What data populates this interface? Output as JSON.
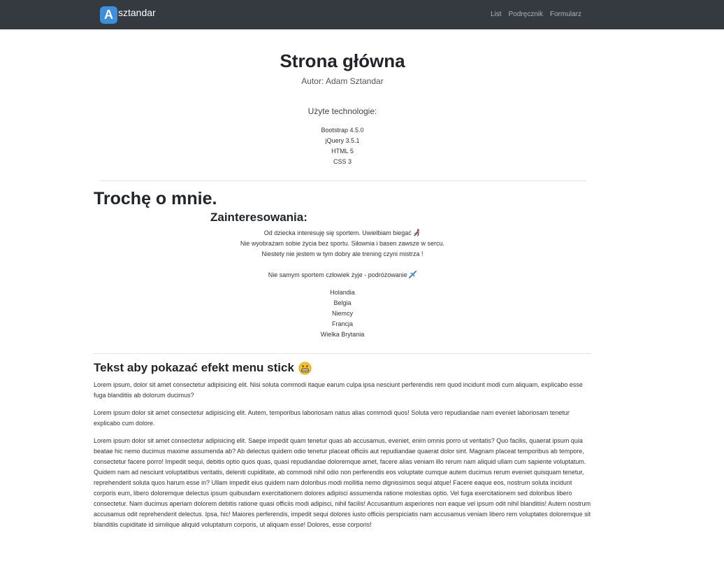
{
  "navbar": {
    "logo_letter": "A",
    "brand_text": "sztandar",
    "links": [
      "List",
      "Podręcznik",
      "Formularz"
    ]
  },
  "header": {
    "title": "Strona główna",
    "author": "Autor: Adam Sztandar",
    "tech_title": "Użyte technologie:",
    "technologies": [
      "Bootstrap 4.5.0",
      "jQuery 3.5.1",
      "HTML 5",
      "CSS 3"
    ]
  },
  "about": {
    "title": "Trochę o mnie.",
    "interests_title": "Zainteresowania:",
    "interests_lines": [
      "Od dziecka interesuję się sportem. Uwielbiam biegać",
      "Nie wyobrażam sobie życia bez sportu. Siłownia i basen zawsze w sercu.",
      "Niestety nie jestem w tym dobry ale trening czyni mistrza !"
    ],
    "travel_line": "Nie samym sportem człowiek żyje - podróżowanie",
    "countries": [
      "Holandia",
      "Belgia",
      "Niemcy",
      "Francja",
      "Wielka Brytania"
    ]
  },
  "sticky": {
    "title": "Tekst aby pokazać efekt menu stick",
    "paragraphs": [
      "Lorem ipsum, dolor sit amet consectetur adipisicing elit. Nisi soluta commodi itaque earum culpa ipsa nesciunt perferendis rem quod incidunt modi cum aliquam, explicabo esse fuga blanditiis ab dolorum ducimus?",
      "Lorem ipsum dolor sit amet consectetur adipisicing elit. Autem, temporibus laboriosam natus alias commodi quos! Soluta vero repudiandae nam eveniet laboriosam tenetur explicabo cum dolore.",
      "Lorem ipsum dolor sit amet consectetur adipisicing elit. Saepe impedit quam tenetur quas ab accusamus, eveniet, enim omnis porro ut veritatis? Quo facilis, quaerat ipsum quia beatae hic nemo ducimus maxime assumenda ab? Ab delectus quidem odio tenetur placeat officiis aut repudiandae quaerat dolor sint. Magnam placeat temporibus ab tempore, consectetur facere porro! Impedit sequi, debitis optio quos quas, quasi repudiandae doloremque amet, facere alias veniam illo rerum nam aliquid ullam cum sapiente voluptatum. Quidem nam ad nesciunt voluptatibus veritatis, deleniti cupiditate, ab commodi nihil odio non perferendis eos voluptate cumque autem ducimus rerum eveniet quisquam tenetur, reprehenderit soluta quos harum esse in? Ullam impedit eius quidem nam doloribus modi mollitia nemo dignissimos sequi atque! Facere eaque eos, nostrum soluta incidunt corporis eum, libero doloremque delectus ipsum quibusdam exercitationem dolores adipisci assumenda ratione molestias optio. Vel fuga exercitationem sed doloribus libero consectetur. Nam ducimus aperiam dolorem debitis ratione quasi officiis modi adipisci, nihil facilis! Accusantium asperiores non eaque vel ipsum odit nihil blanditiis! Autem nostrum accusamus odit reprehenderit delectus. Ipsa, hic! Maiores perferendis, impedit sequi dolores iusto officiis perspiciatis nam accusamus veniam libero rem voluptates doloremque sit blanditiis cupiditate id similique aliquid voluptatum corporis, ut aliquam esse! Dolores, esse corporis!"
    ]
  },
  "icons": {
    "runner": "runner-emoji-icon",
    "airplane": "airplane-emoji-icon",
    "grin": "grinning-face-emoji-icon"
  },
  "colors": {
    "navbar_bg": "#343a40",
    "logo_bg": "#3d8edb",
    "nav_link": "rgba(255,255,255,0.6)"
  }
}
